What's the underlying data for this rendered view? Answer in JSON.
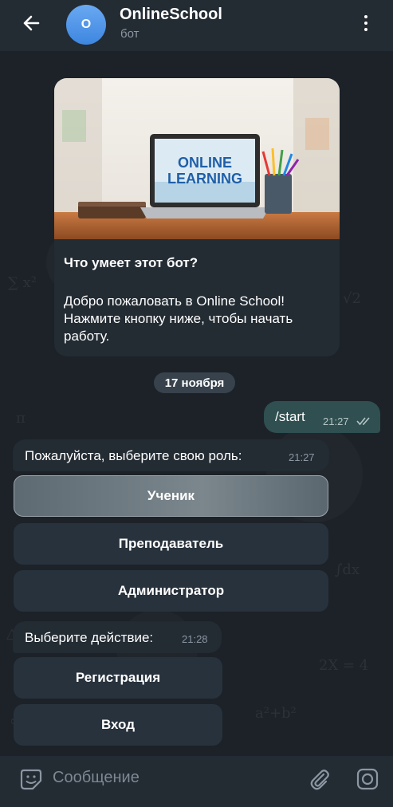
{
  "header": {
    "avatar_letter": "O",
    "title": "OnlineSchool",
    "subtitle": "бот"
  },
  "intro": {
    "image_text_line1": "ONLINE",
    "image_text_line2": "LEARNING",
    "heading": "Что умеет этот бот?",
    "text": "Добро пожаловать в Online School! Нажмите кнопку ниже, чтобы начать работу."
  },
  "date_chip": "17 ноября",
  "outgoing": {
    "text": "/start",
    "time": "21:27"
  },
  "role_message": {
    "text": "Пожалуйста, выберите свою роль:",
    "time": "21:27"
  },
  "role_buttons": [
    "Ученик",
    "Преподаватель",
    "Администратор"
  ],
  "action_message": {
    "text": "Выберите действие:",
    "time": "21:28"
  },
  "action_buttons": [
    "Регистрация",
    "Вход"
  ],
  "composer": {
    "placeholder": "Сообщение"
  },
  "icons": {
    "back": "arrow-left-icon",
    "menu": "more-vertical-icon",
    "emoji": "sticker-smile-icon",
    "attach": "paperclip-icon",
    "camera": "camera-icon",
    "read": "double-check-icon"
  },
  "colors": {
    "header_bg": "#232b33",
    "avatar": "#4a90e2",
    "outgoing_bubble": "#2f4f51",
    "incoming_bubble": "#232b33"
  }
}
